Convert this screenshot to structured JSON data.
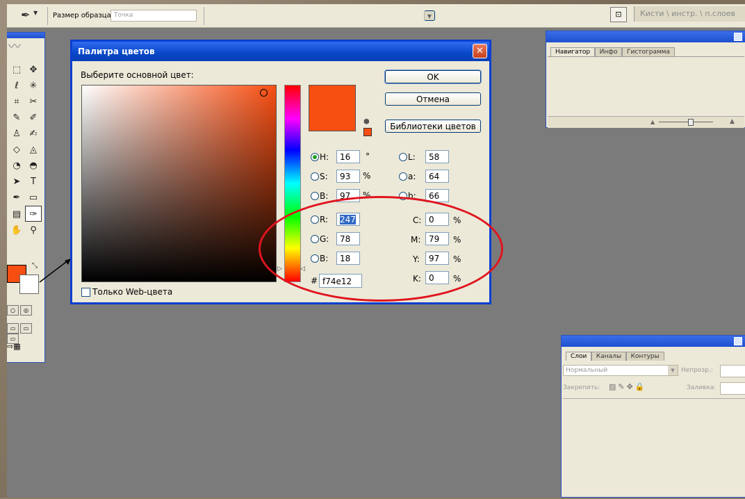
{
  "options_bar": {
    "sample_size_label": "Размер образца:",
    "sample_size_value": "Точка",
    "panel_well_text": "Кисти \\ инстр. \\ п.слоев"
  },
  "color_picker": {
    "title": "Палитра цветов",
    "close_label": "✕",
    "prompt": "Выберите основной цвет:",
    "ok_label": "OK",
    "cancel_label": "Отмена",
    "libraries_label": "Библиотеки цветов",
    "current_color": "#f74e12",
    "hsb": {
      "h_label": "H:",
      "h_value": "16",
      "h_unit": "°",
      "s_label": "S:",
      "s_value": "93",
      "s_unit": "%",
      "b_label": "B:",
      "b_value": "97",
      "b_unit": "%"
    },
    "lab": {
      "l_label": "L:",
      "l_value": "58",
      "a_label": "a:",
      "a_value": "64",
      "b_label": "b:",
      "b_value": "66"
    },
    "rgb": {
      "r_label": "R:",
      "r_value": "247",
      "g_label": "G:",
      "g_value": "78",
      "b_label": "B:",
      "b_value": "18"
    },
    "cmyk": {
      "c_label": "C:",
      "c_value": "0",
      "m_label": "M:",
      "m_value": "79",
      "y_label": "Y:",
      "y_value": "97",
      "k_label": "K:",
      "k_value": "0",
      "unit": "%"
    },
    "hex_label": "#",
    "hex_value": "f74e12",
    "web_only_label": "Только Web-цвета"
  },
  "navigator_panel": {
    "tabs": [
      "Навигатор",
      "Инфо",
      "Гистограмма"
    ]
  },
  "layers_panel": {
    "tabs": [
      "Слои",
      "Каналы",
      "Контуры"
    ],
    "blend_mode": "Нормальный",
    "opacity_label": "Непрозр.:",
    "lock_label": "Закрепить:",
    "fill_label": "Заливка:"
  },
  "colors": {
    "accent_title": "#0a3fd1",
    "foreground": "#f74e12",
    "annotation": "#e0141e"
  }
}
